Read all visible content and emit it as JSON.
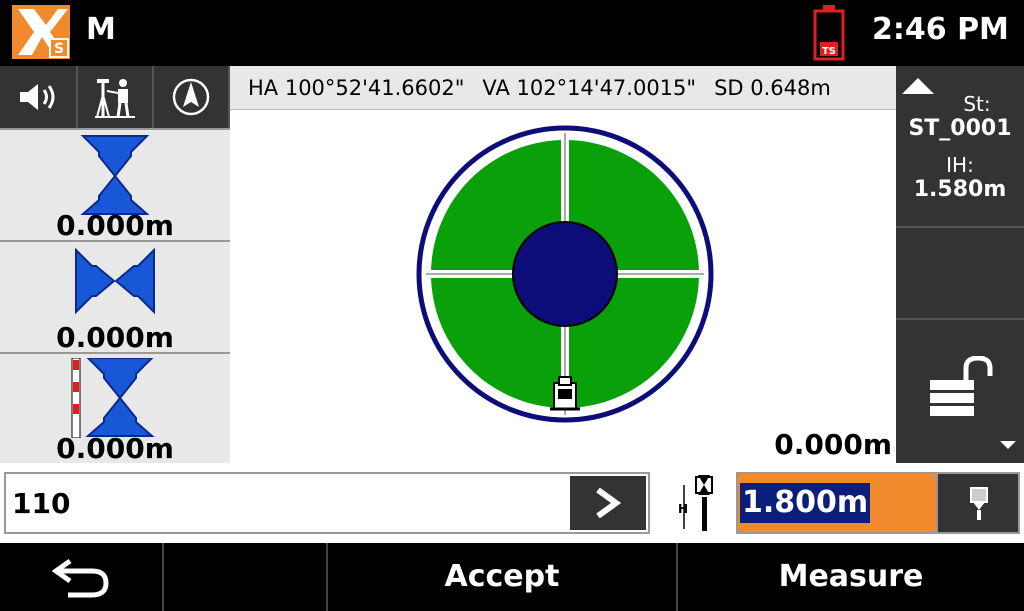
{
  "titlebar": {
    "mode": "M",
    "clock": "2:46 PM",
    "logo_badge": "S",
    "battery_badge": "TS"
  },
  "measurements": {
    "ha": "HA 100°52'41.6602\"",
    "va": "VA 102°14'47.0015\"",
    "sd": "SD 0.648m"
  },
  "left_panels": [
    {
      "value": "0.000m",
      "icon": "arrows-vertical-icon"
    },
    {
      "value": "0.000m",
      "icon": "arrows-horizontal-icon"
    },
    {
      "value": "0.000m",
      "icon": "arrows-rod-icon"
    }
  ],
  "target_view": {
    "distance": "0.000m"
  },
  "station": {
    "st_label": "St:",
    "st_value": "ST_0001",
    "ih_label": "IH:",
    "ih_value": "1.580m"
  },
  "input": {
    "point_id": "110",
    "target_height": "1.800m"
  },
  "bottom_bar": {
    "accept": "Accept",
    "measure": "Measure"
  },
  "colors": {
    "green": "#0aa00a",
    "navy": "#0d0d7a",
    "orange": "#f08a2c",
    "logo": "#f08a2c"
  }
}
